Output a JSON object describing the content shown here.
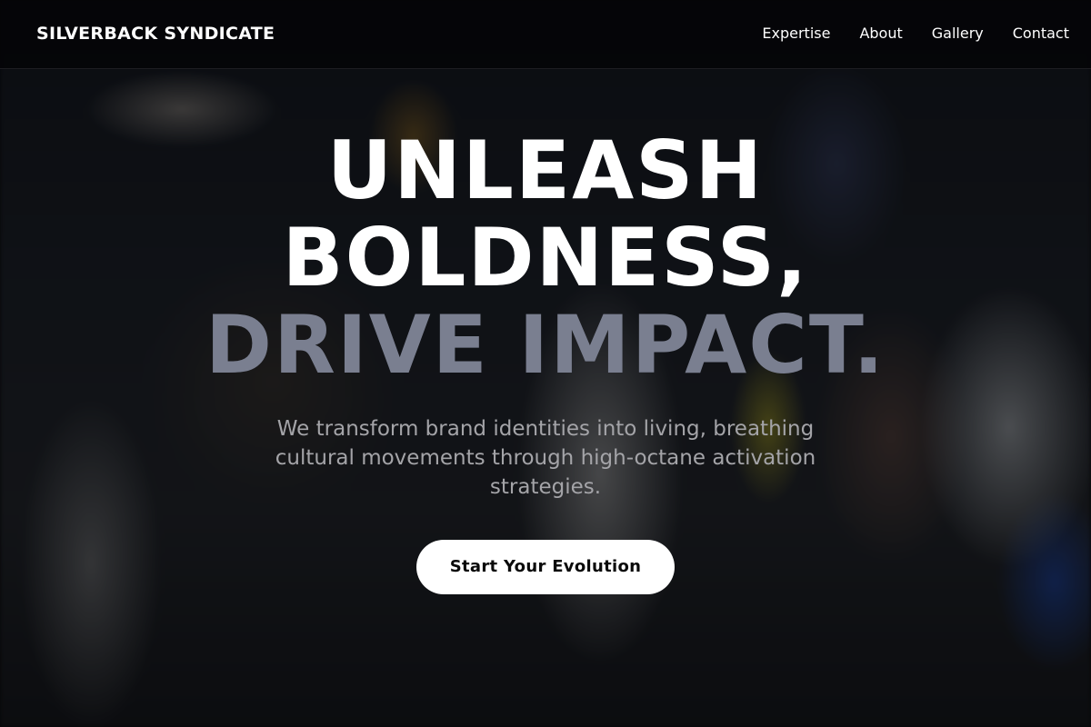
{
  "header": {
    "brand": "SILVERBACK SYNDICATE",
    "nav": [
      "Expertise",
      "About",
      "Gallery",
      "Contact"
    ]
  },
  "hero": {
    "headline_line1": "UNLEASH",
    "headline_line2": "BOLDNESS,",
    "headline_line3": "DRIVE IMPACT.",
    "subtitle": "We transform brand identities into living, breathing cultural movements through high-octane activation strategies.",
    "cta_label": "Start Your Evolution"
  },
  "colors": {
    "header_bg": "#050507",
    "headline": "#ffffff",
    "headline_accent": "#7a7f90",
    "subtitle": "#a4a4a8",
    "cta_bg": "#ffffff",
    "cta_text": "#0a0a0a"
  }
}
